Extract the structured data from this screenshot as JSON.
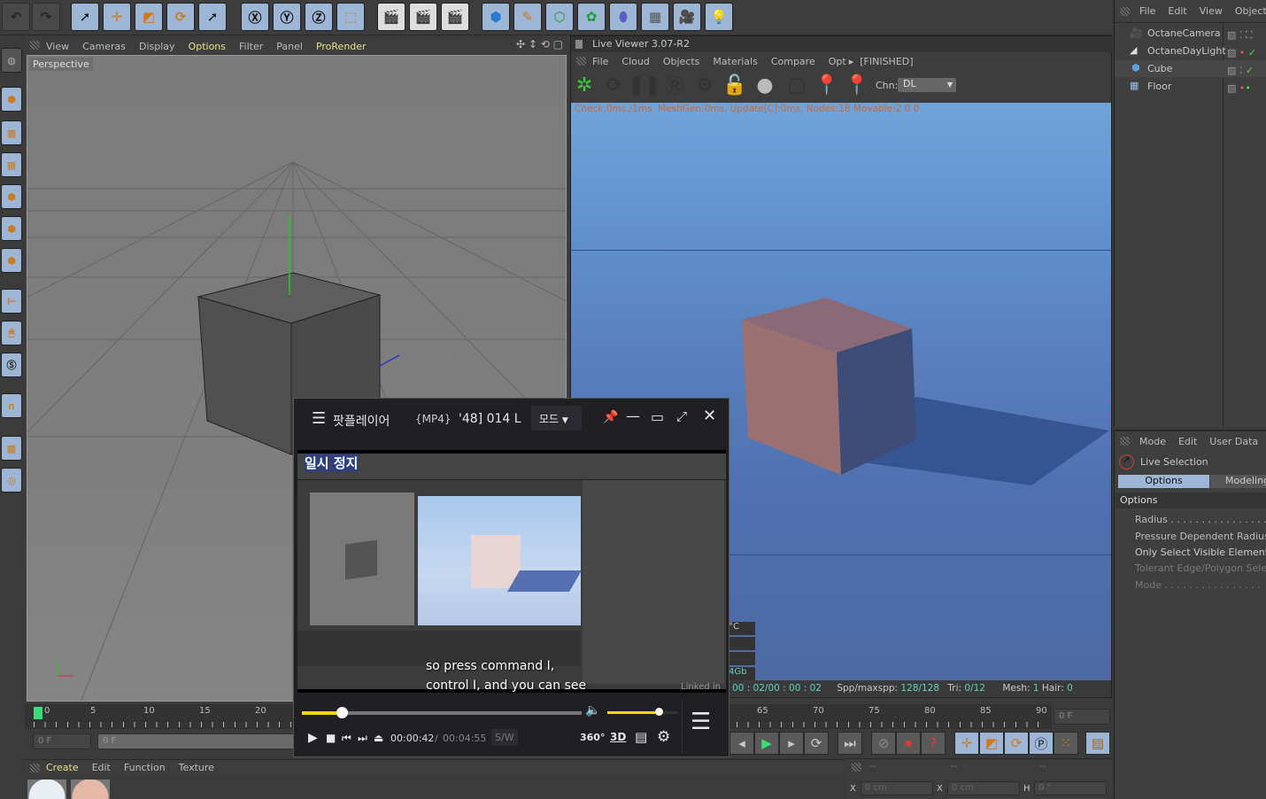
{
  "viewport": {
    "menu": [
      "View",
      "Cameras",
      "Display",
      "Options",
      "Filter",
      "Panel",
      "ProRender"
    ],
    "label": "Perspective"
  },
  "live_viewer": {
    "title": "Live Viewer 3.07-R2",
    "menu": [
      "File",
      "Cloud",
      "Objects",
      "Materials",
      "Compare",
      "Opt"
    ],
    "state": "[FINISHED]",
    "channel_label": "Chn:",
    "channel_value": "DL",
    "stats": "Check:0ms./1ms. MeshGen:0ms. Update[C]:0ms. Nodes:18 Movable:2  0 0",
    "side_vals": [
      "°C",
      "",
      "",
      "4Gb"
    ],
    "status": {
      "time": "00 : 02/00 : 00 : 02",
      "spp_label": "Spp/maxspp:",
      "spp": "128/128",
      "tri_label": "Tri:",
      "tri": "0/12",
      "mesh_label": "Mesh:",
      "mesh": "1",
      "hair_label": "Hair:",
      "hair": "0"
    }
  },
  "objects": {
    "menu": [
      "File",
      "Edit",
      "View",
      "Objects"
    ],
    "items": [
      "OctaneCamera",
      "OctaneDayLight",
      "Cube",
      "Floor"
    ]
  },
  "attributes": {
    "menu": [
      "Mode",
      "Edit",
      "User Data"
    ],
    "tool": "Live Selection",
    "tabs": [
      "Options",
      "Modeling"
    ],
    "section": "Options",
    "fields": [
      "Radius . . . . . . . . . . . . . . . .",
      "Pressure Dependent Radius.",
      "Only Select Visible Elements",
      "Tolerant Edge/Polygon Selec",
      "Mode . . . . . . . . . . . . . . . ."
    ]
  },
  "timeline": {
    "ticks_left": [
      "0",
      "5",
      "10",
      "15",
      "20"
    ],
    "ticks_right": [
      "65",
      "70",
      "75",
      "80",
      "85",
      "90"
    ],
    "frame_start": "0 F",
    "frame_cur": "0 F",
    "frame_end": "0 F"
  },
  "materials": {
    "menu": [
      "Create",
      "Edit",
      "Function",
      "Texture"
    ]
  },
  "coords": {
    "headers": [
      "--",
      "--",
      "--"
    ],
    "x1_label": "X",
    "x1": "0 cm",
    "x2_label": "X",
    "x2": "0 cm",
    "h_label": "H",
    "h": "0 °"
  },
  "player": {
    "app": "팟플레이어",
    "file_fmt": "{MP4}",
    "file_name": "'48] 014 L",
    "mode": "모드",
    "overlay": "일시 정지",
    "subtitle1": "so press command I,",
    "subtitle2": "control I, and you can see",
    "watermark": "Linked in",
    "time_cur": "00:00:42",
    "time_sep": "/",
    "time_total": "00:04:55",
    "sw": "S/W",
    "btn_360": "360°",
    "btn_3d": "3D",
    "progress": 0.142,
    "volume": 0.85
  },
  "colors": {
    "accent_yellow": "#f5d800",
    "c4d_highlight": "#9db6d6",
    "stat_teal": "#5fd0c0"
  }
}
